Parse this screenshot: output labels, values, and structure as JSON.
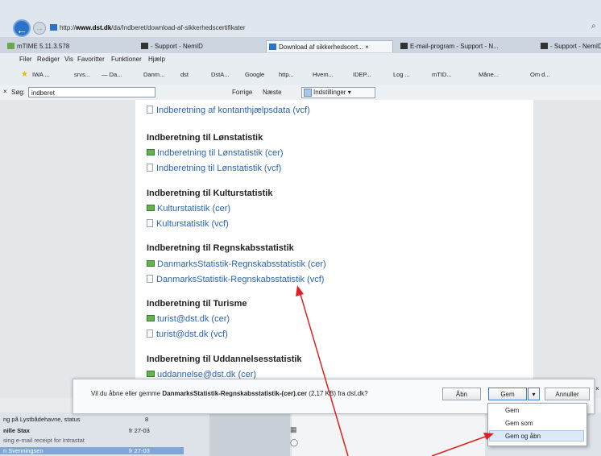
{
  "browser": {
    "url": "http://www.dst.dk/da/Indberet/download-af-sikkerhedscertifikater",
    "url_prefix": "http://",
    "url_domain": "www.dst.dk",
    "url_path": "/da/Indberet/download-af-sikkerhedscertifikater",
    "tabs": [
      {
        "label": "mTIME 5.11.3.578",
        "active": false
      },
      {
        "label": "- Support - NemID",
        "active": false
      },
      {
        "label": "Download af sikkerhedscert... ×",
        "active": true
      },
      {
        "label": "E-mail-program - Support - N...",
        "active": false
      },
      {
        "label": "- Support - NemID",
        "active": false
      }
    ],
    "menu": [
      "Filer",
      "Rediger",
      "Vis",
      "Favoritter",
      "Funktioner",
      "Hjælp"
    ],
    "favorites": [
      "IWA ...",
      "srvs...",
      "— Da...",
      "Danm...",
      "dst",
      "DstA...",
      "Google",
      "http...",
      "Hvem...",
      "IDEP...",
      "Log ...",
      "mTID...",
      "Måne...",
      "Om d..."
    ],
    "find": {
      "label": "Søg:",
      "value": "indberet",
      "prev": "Forrige",
      "next": "Næste",
      "options": "Indstillinger ▾",
      "close": "×"
    }
  },
  "page": {
    "top_link": "Indberetning af kontanthjælpsdata (vcf)",
    "sections": [
      {
        "title": "Indberetning til Lønstatistik",
        "links": [
          {
            "type": "cer",
            "text": "Indberetning til Lønstatistik (cer)"
          },
          {
            "type": "vcf",
            "text": "Indberetning til Lønstatistik (vcf)"
          }
        ]
      },
      {
        "title": "Indberetning til Kulturstatistik",
        "links": [
          {
            "type": "cer",
            "text": "Kulturstatistik (cer)"
          },
          {
            "type": "vcf",
            "text": "Kulturstatistik (vcf)"
          }
        ]
      },
      {
        "title": "Indberetning til Regnskabsstatistik",
        "links": [
          {
            "type": "cer",
            "text": "DanmarksStatistik-Regnskabsstatistik (cer)"
          },
          {
            "type": "vcf",
            "text": "DanmarksStatistik-Regnskabsstatistik (vcf)"
          }
        ]
      },
      {
        "title": "Indberetning til Turisme",
        "links": [
          {
            "type": "cer",
            "text": "turist@dst.dk (cer)"
          },
          {
            "type": "vcf",
            "text": "turist@dst.dk (vcf)"
          }
        ]
      },
      {
        "title": "Indberetning til Uddannelsesstatistik",
        "links": [
          {
            "type": "cer",
            "text": "uddannelse@dst.dk (cer)"
          }
        ]
      }
    ]
  },
  "download": {
    "prefix": "Vil du åbne eller gemme ",
    "filename": "DanmarksStatistik-Regnskabsstatistik-(cer).cer",
    "suffix": " (2,17 KB) fra dst.dk?",
    "open": "Åbn",
    "save": "Gem",
    "dropdown": "▾",
    "cancel": "Annuller",
    "close": "×",
    "menu": [
      "Gem",
      "Gem som",
      "Gem og åbn"
    ]
  },
  "mail": {
    "rows": [
      {
        "subject": "ng på Lystbådehavne, status",
        "date": "8"
      },
      {
        "subject": "nille Stax",
        "date": "fr 27-03"
      },
      {
        "subject": "sing e-mail receipt for Intrastat",
        "date": ""
      },
      {
        "subject": "n Svenningsen",
        "date": "fr 27-03"
      }
    ]
  },
  "colors": {
    "link": "#2a64b0",
    "arrow": "#e02020",
    "accent": "#2b72c9"
  }
}
